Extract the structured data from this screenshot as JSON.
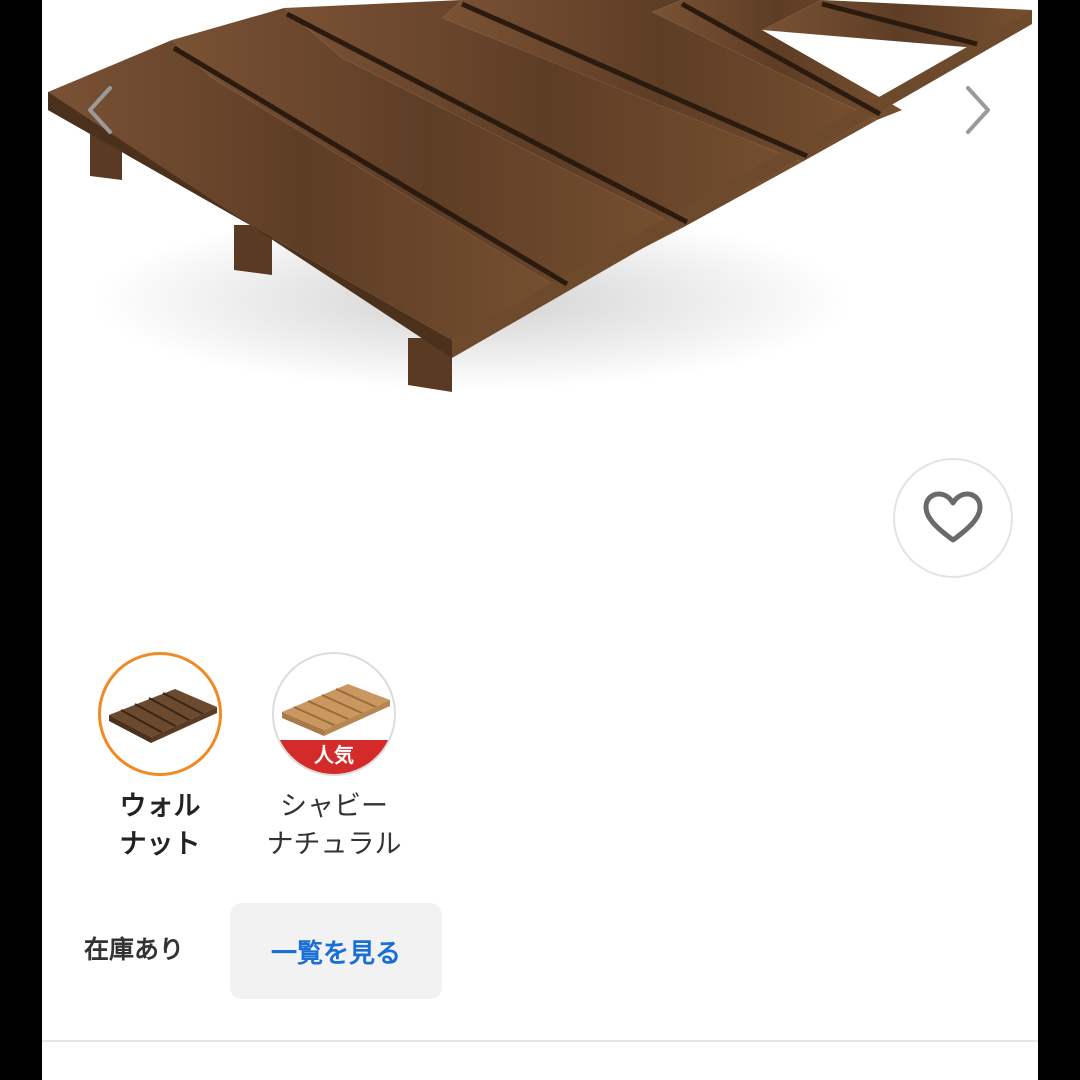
{
  "product": {
    "image_alt": "walnut slatted bed frame",
    "favorite_icon": "heart-outline-icon",
    "prev_icon": "chevron-left-icon",
    "next_icon": "chevron-right-icon"
  },
  "variants": [
    {
      "label": "ウォル\nナット",
      "selected": true,
      "color": "#6b4a2f"
    },
    {
      "label": "シャビー\nナチュラル",
      "selected": false,
      "color": "#c9975f",
      "badge": "人気"
    }
  ],
  "stock": {
    "status": "在庫あり",
    "view_all_label": "一覧を見る"
  },
  "colors": {
    "selected_border": "#f08a24",
    "badge_red": "#d42a2a",
    "link_blue": "#1a6fd6"
  }
}
